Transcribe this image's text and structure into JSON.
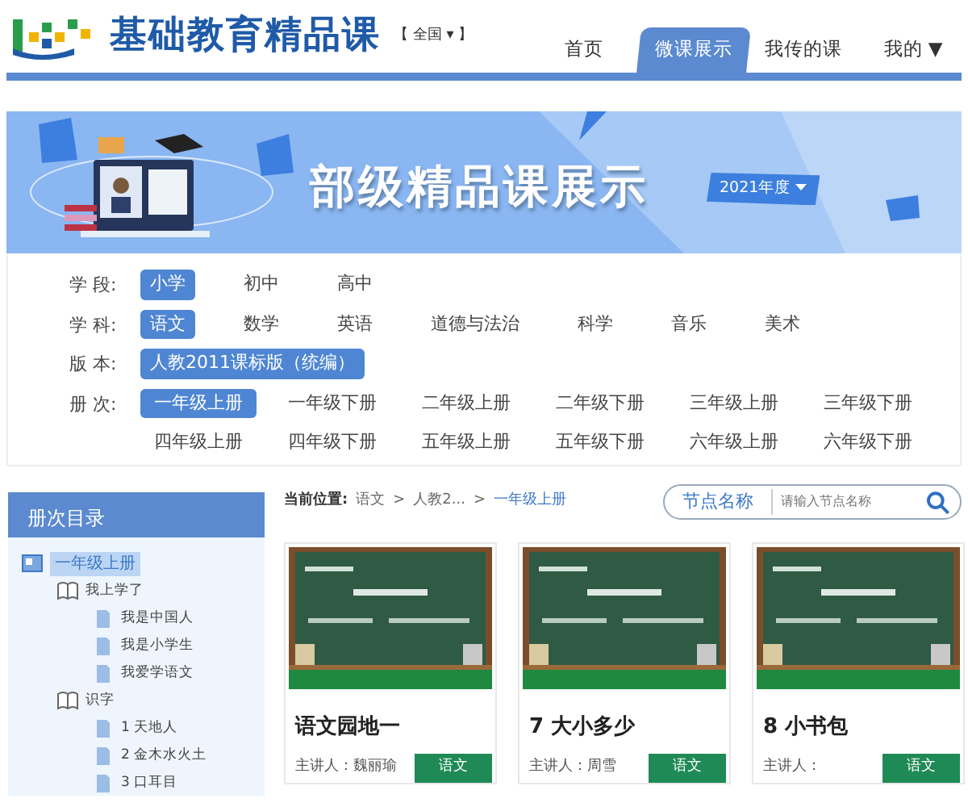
{
  "header": {
    "site_title": "基础教育精品课",
    "region": "【 全国 ▾ 】"
  },
  "nav": [
    {
      "label": "首页",
      "selected": false
    },
    {
      "label": "微课展示",
      "selected": true
    },
    {
      "label": "我传的课",
      "selected": false
    },
    {
      "label": "我的 ▼",
      "selected": false
    }
  ],
  "banner": {
    "title": "部级精品课展示",
    "year": "2021年度"
  },
  "filters": [
    {
      "label": "学 段:",
      "kind": "inline",
      "options": [
        {
          "label": "小学",
          "selected": true
        },
        {
          "label": "初中",
          "selected": false
        },
        {
          "label": "高中",
          "selected": false
        }
      ]
    },
    {
      "label": "学 科:",
      "kind": "inline",
      "options": [
        {
          "label": "语文",
          "selected": true
        },
        {
          "label": "数学",
          "selected": false
        },
        {
          "label": "英语",
          "selected": false
        },
        {
          "label": "道德与法治",
          "selected": false
        },
        {
          "label": "科学",
          "selected": false
        },
        {
          "label": "音乐",
          "selected": false
        },
        {
          "label": "美术",
          "selected": false
        }
      ]
    },
    {
      "label": "版 本:",
      "kind": "inline",
      "options": [
        {
          "label": "人教2011课标版（统编）",
          "selected": true
        }
      ]
    },
    {
      "label": "册 次:",
      "kind": "grid",
      "options": [
        {
          "label": "一年级上册",
          "selected": true
        },
        {
          "label": "一年级下册",
          "selected": false
        },
        {
          "label": "二年级上册",
          "selected": false
        },
        {
          "label": "二年级下册",
          "selected": false
        },
        {
          "label": "三年级上册",
          "selected": false
        },
        {
          "label": "三年级下册",
          "selected": false
        },
        {
          "label": "四年级上册",
          "selected": false
        },
        {
          "label": "四年级下册",
          "selected": false
        },
        {
          "label": "五年级上册",
          "selected": false
        },
        {
          "label": "五年级下册",
          "selected": false
        },
        {
          "label": "六年级上册",
          "selected": false
        },
        {
          "label": "六年级下册",
          "selected": false
        }
      ]
    }
  ],
  "sidebar": {
    "title": "册次目录",
    "tree": [
      {
        "label": "一年级上册",
        "kind": "volume",
        "selected": true,
        "children": [
          {
            "label": "我上学了",
            "kind": "unit",
            "selected": false,
            "children": [
              {
                "label": "我是中国人",
                "kind": "lesson",
                "selected": false
              },
              {
                "label": "我是小学生",
                "kind": "lesson",
                "selected": false
              },
              {
                "label": "我爱学语文",
                "kind": "lesson",
                "selected": false
              }
            ]
          },
          {
            "label": "识字",
            "kind": "unit",
            "selected": false,
            "children": [
              {
                "label": "1 天地人",
                "kind": "lesson",
                "selected": false
              },
              {
                "label": "2 金木水火土",
                "kind": "lesson",
                "selected": false
              },
              {
                "label": "3 口耳目",
                "kind": "lesson",
                "selected": false
              }
            ]
          }
        ]
      }
    ]
  },
  "breadcrumb": {
    "label": "当前位置:",
    "separator": ">",
    "items": [
      {
        "label": "语文",
        "current": false
      },
      {
        "label": "人教2...",
        "current": false
      },
      {
        "label": "一年级上册",
        "current": true
      }
    ]
  },
  "search": {
    "scope": "节点名称",
    "placeholder": "请输入节点名称"
  },
  "courses": [
    {
      "title": "语文园地一",
      "presenter": "主讲人：魏丽瑜",
      "tag": "语文"
    },
    {
      "title": "7 大小多少",
      "presenter": "主讲人：周雪",
      "tag": "语文"
    },
    {
      "title": "8 小书包",
      "presenter": "主讲人：",
      "tag": "语文"
    }
  ]
}
